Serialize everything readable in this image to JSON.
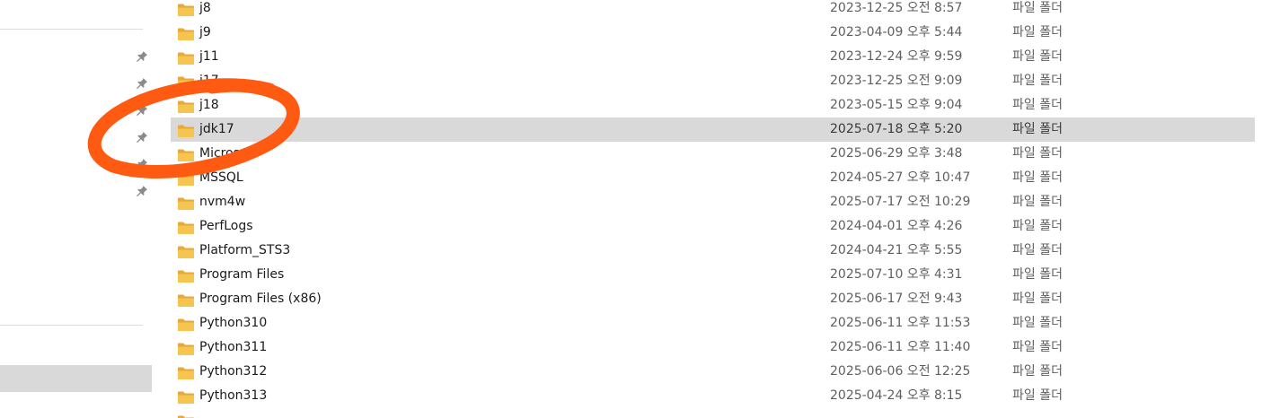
{
  "colors": {
    "selection": "#d9d9d9",
    "folder": "#f5c54f",
    "annotation": "#ff5a12",
    "pin": "#8a8a8a"
  },
  "sidebar": {
    "pins": [
      "pin-icon",
      "pin-icon",
      "pin-icon",
      "pin-icon",
      "pin-icon",
      "pin-icon"
    ]
  },
  "files": [
    {
      "name": "j8",
      "date": "2023-12-25 오전 8:57",
      "type": "파일 폴더",
      "icon": "folder-icon"
    },
    {
      "name": "j9",
      "date": "2023-04-09 오후 5:44",
      "type": "파일 폴더",
      "icon": "folder-icon"
    },
    {
      "name": "j11",
      "date": "2023-12-24 오후 9:59",
      "type": "파일 폴더",
      "icon": "folder-icon"
    },
    {
      "name": "j17",
      "date": "2023-12-25 오전 9:09",
      "type": "파일 폴더",
      "icon": "folder-icon"
    },
    {
      "name": "j18",
      "date": "2023-05-15 오후 9:04",
      "type": "파일 폴더",
      "icon": "folder-icon"
    },
    {
      "name": "jdk17",
      "date": "2025-07-18 오후 5:20",
      "type": "파일 폴더",
      "icon": "folder-icon",
      "selected": true
    },
    {
      "name": "Microsoft",
      "date": "2025-06-29 오후 3:48",
      "type": "파일 폴더",
      "icon": "folder-icon"
    },
    {
      "name": "MSSQL",
      "date": "2024-05-27 오후 10:47",
      "type": "파일 폴더",
      "icon": "folder-icon"
    },
    {
      "name": "nvm4w",
      "date": "2025-07-17 오전 10:29",
      "type": "파일 폴더",
      "icon": "folder-icon"
    },
    {
      "name": "PerfLogs",
      "date": "2024-04-01 오후 4:26",
      "type": "파일 폴더",
      "icon": "folder-icon"
    },
    {
      "name": "Platform_STS3",
      "date": "2024-04-21 오후 5:55",
      "type": "파일 폴더",
      "icon": "folder-icon"
    },
    {
      "name": "Program Files",
      "date": "2025-07-10 오후 4:31",
      "type": "파일 폴더",
      "icon": "folder-icon"
    },
    {
      "name": "Program Files (x86)",
      "date": "2025-06-17 오전 9:43",
      "type": "파일 폴더",
      "icon": "folder-icon"
    },
    {
      "name": "Python310",
      "date": "2025-06-11 오후 11:53",
      "type": "파일 폴더",
      "icon": "folder-icon"
    },
    {
      "name": "Python311",
      "date": "2025-06-11 오후 11:40",
      "type": "파일 폴더",
      "icon": "folder-icon"
    },
    {
      "name": "Python312",
      "date": "2025-06-06 오전 12:25",
      "type": "파일 폴더",
      "icon": "folder-icon"
    },
    {
      "name": "Python313",
      "date": "2025-04-24 오후 8:15",
      "type": "파일 폴더",
      "icon": "folder-icon"
    },
    {
      "name": "",
      "date": "",
      "type": "",
      "icon": "folder-icon"
    }
  ]
}
